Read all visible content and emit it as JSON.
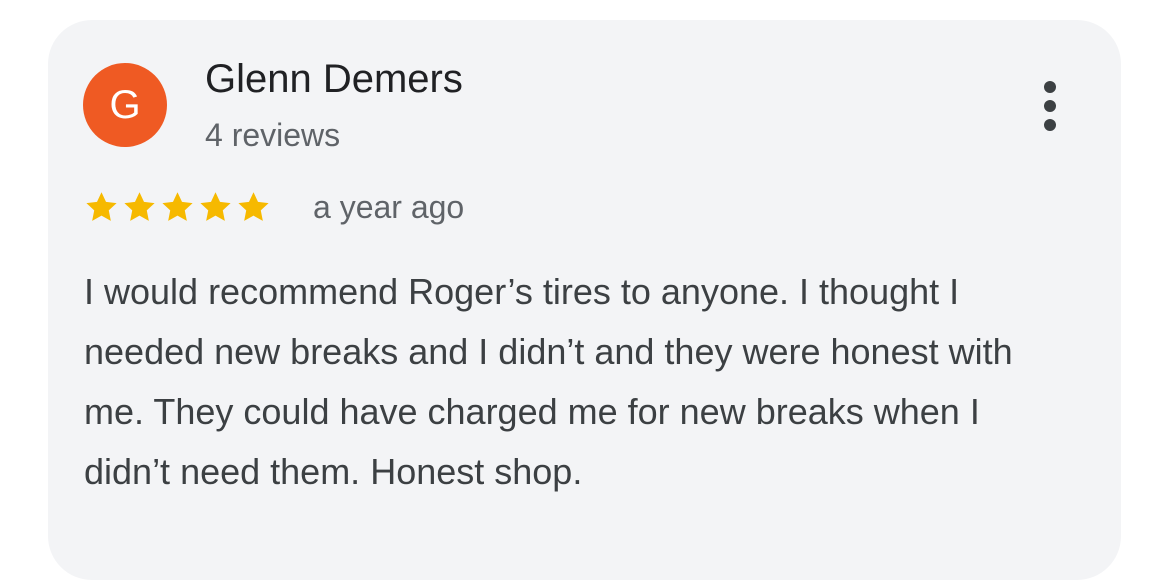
{
  "review": {
    "avatar_letter": "G",
    "reviewer_name": "Glenn Demers",
    "review_count": "4 reviews",
    "rating": 5,
    "date": "a year ago",
    "text": "I would recommend Roger’s tires to anyone. I thought I needed new breaks and I didn’t and they were honest with me. They could have charged me for new breaks when I didn’t need them. Honest shop."
  },
  "icons": {
    "star": "star-icon",
    "more": "more-vertical-icon"
  },
  "colors": {
    "avatar_bg": "#ef5a23",
    "star": "#f6b900",
    "card_bg": "#f3f4f6"
  }
}
